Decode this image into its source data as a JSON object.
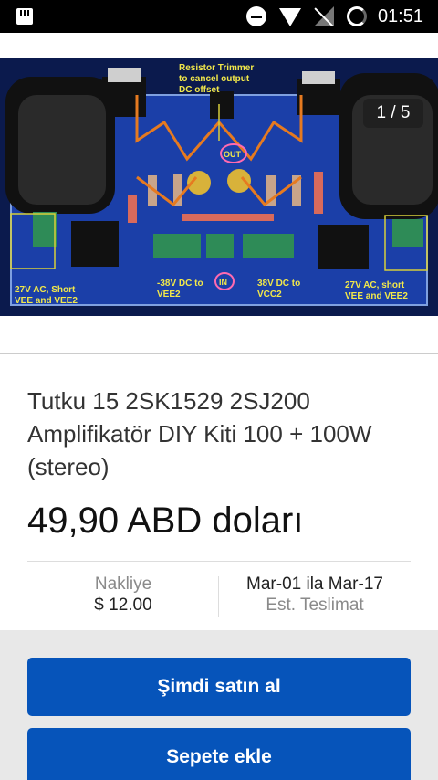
{
  "status_bar": {
    "time": "01:51"
  },
  "image": {
    "counter": "1 / 5",
    "labels": {
      "trimmer": "Resistor Trimmer",
      "trimmer2": "to cancel output",
      "trimmer3": "DC offset",
      "left_ac": "27V AC, Short",
      "left_ac2": "VEE and VEE2",
      "right_ac": "27V AC, short",
      "right_ac2": "VEE and VEE2",
      "minus38": "-38V DC to",
      "minus38b": "VEE2",
      "plus38": "38V DC to",
      "plus38b": "VCC2",
      "in": "IN",
      "out": "OUT"
    }
  },
  "product": {
    "title": "Tutku 15 2SK1529 2SJ200 Amplifikatör DIY Kiti 100 + 100W (stereo)",
    "price": "49,90 ABD doları"
  },
  "shipping": {
    "label": "Nakliye",
    "cost": "$ 12.00",
    "delivery_dates": "Mar-01 ila Mar-17",
    "delivery_label": "Est. Teslimat"
  },
  "actions": {
    "buy_now": "Şimdi satın al",
    "add_to_cart": "Sepete ekle"
  },
  "colors": {
    "primary_button": "#0654ba",
    "pcb_blue": "#1b3fa8"
  }
}
